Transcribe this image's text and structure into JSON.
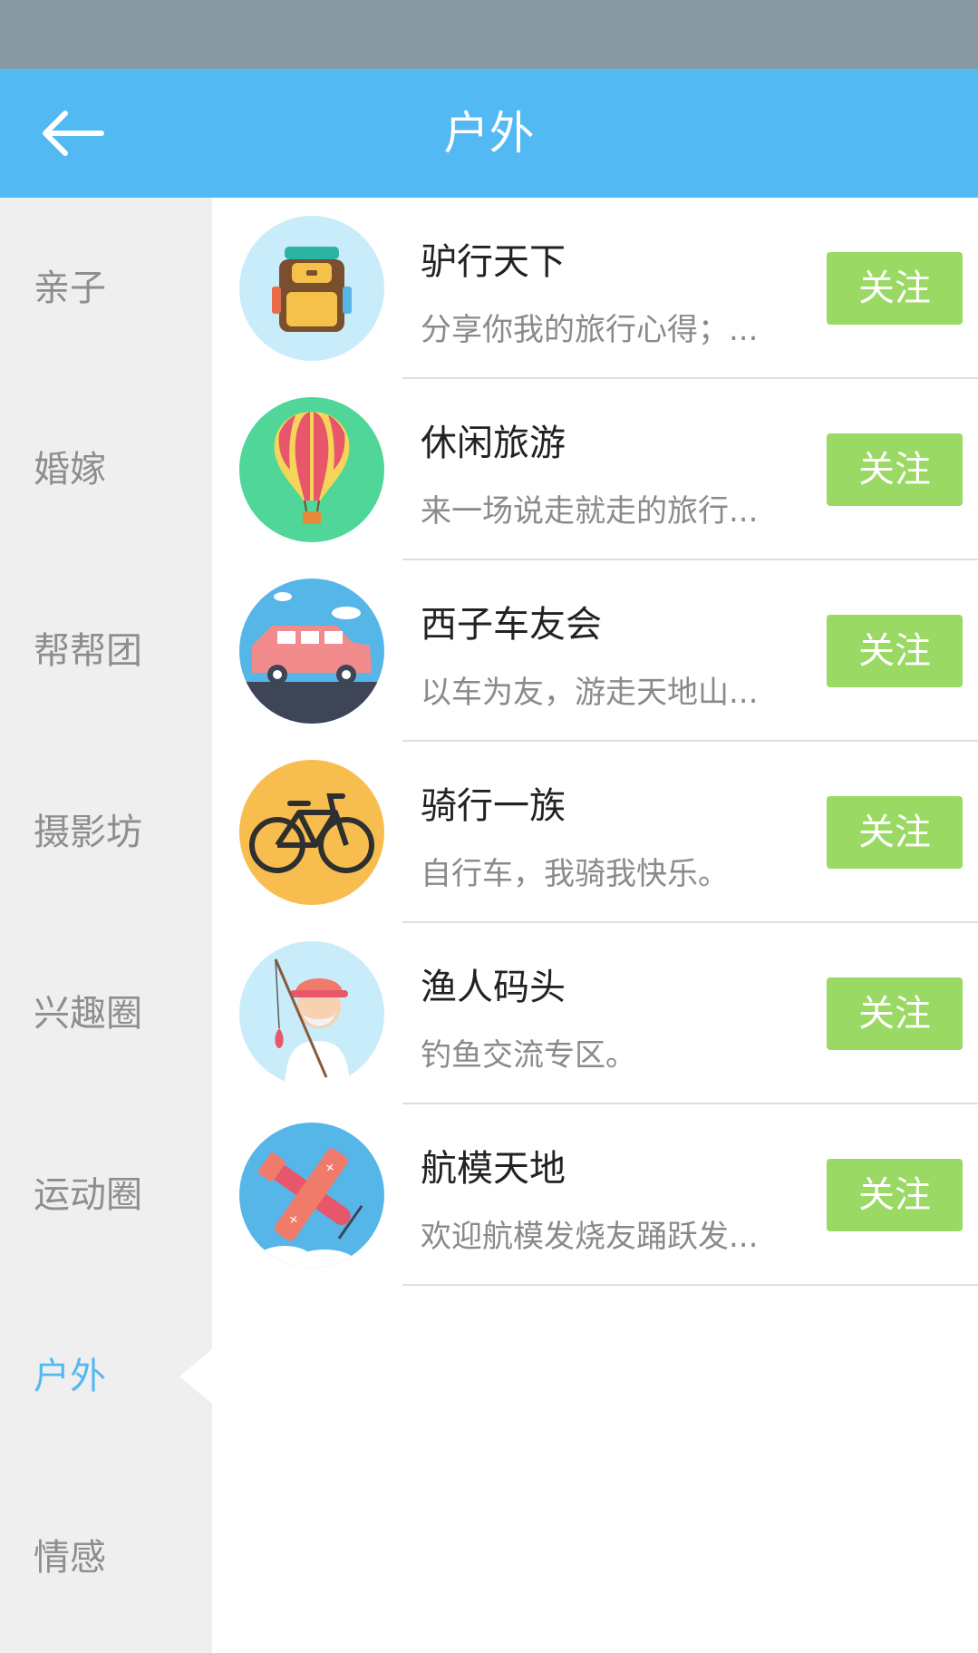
{
  "header": {
    "title": "户外",
    "back_icon": "arrow-left-icon"
  },
  "colors": {
    "status_bar": "#879aa4",
    "app_bar": "#53b9f3",
    "sidebar_bg": "#efefef",
    "sidebar_text": "#8e8e8e",
    "active_text": "#53b9f3",
    "follow_button": "#9ad963"
  },
  "sidebar": {
    "active_index": 6,
    "items": [
      {
        "label": "亲子"
      },
      {
        "label": "婚嫁"
      },
      {
        "label": "帮帮团"
      },
      {
        "label": "摄影坊"
      },
      {
        "label": "兴趣圈"
      },
      {
        "label": "运动圈"
      },
      {
        "label": "户外"
      },
      {
        "label": "情感"
      }
    ]
  },
  "groups": [
    {
      "title": "驴行天下",
      "desc": "分享你我的旅行心得；...",
      "button": "关注",
      "icon": "backpack-icon"
    },
    {
      "title": "休闲旅游",
      "desc": "来一场说走就走的旅行...",
      "button": "关注",
      "icon": "hot-air-balloon-icon"
    },
    {
      "title": "西子车友会",
      "desc": "以车为友，游走天地山...",
      "button": "关注",
      "icon": "car-icon"
    },
    {
      "title": "骑行一族",
      "desc": "自行车，我骑我快乐。",
      "button": "关注",
      "icon": "bicycle-icon"
    },
    {
      "title": "渔人码头",
      "desc": "钓鱼交流专区。",
      "button": "关注",
      "icon": "fisherman-icon"
    },
    {
      "title": "航模天地",
      "desc": "欢迎航模发烧友踊跃发...",
      "button": "关注",
      "icon": "model-airplane-icon"
    }
  ]
}
